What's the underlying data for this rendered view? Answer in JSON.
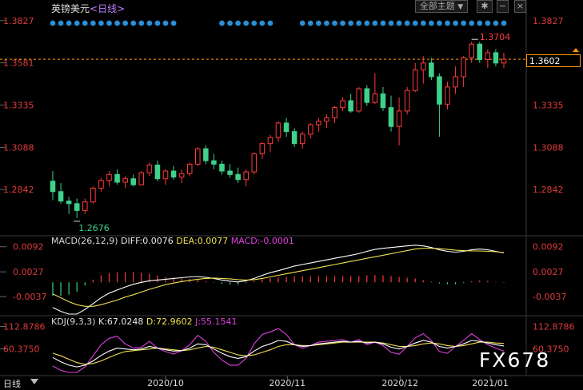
{
  "header": {
    "symbol_name": "英镑美元",
    "period_label": "<日线>",
    "theme_button": "全部主题",
    "theme_caret": "▼",
    "settings_glyph": "✱",
    "minus_glyph": "−",
    "close_glyph": "×"
  },
  "macd": {
    "label": "MACD(26,12,9)",
    "diff_text": "DIFF:0.0076",
    "dea_text": "DEA:0.0077",
    "macd_text": "MACD:-0.0001"
  },
  "kdj": {
    "label": "KDJ(9,3,3)",
    "k_text": "K:67.0248",
    "d_text": "D:72.9602",
    "j_text": "J:55.1541"
  },
  "price_badge": "1.3602",
  "bottom_bar": {
    "period": "日线"
  },
  "watermark": "FX678",
  "colors": {
    "up": "#ff3b3b",
    "down": "#3fd18a",
    "axis_label": "#e03a3a",
    "event_dot": "#2a8fd8",
    "dashed_line": "#ff9a00",
    "diff_line": "#ffffff",
    "dea_line": "#f0e050",
    "j_line": "#e040e0"
  },
  "chart_data": [
    {
      "type": "candlestick",
      "y_ticks": [
        "1.3827",
        "1.3581",
        "1.3335",
        "1.3088",
        "1.2842"
      ],
      "ylim": [
        1.2596,
        1.3882
      ],
      "x_ticks": [
        "2020/10",
        "2020/11",
        "2020/12",
        "2021/01"
      ],
      "dashed_level": 1.3602,
      "annotations": [
        {
          "label": "1.3704",
          "value": 1.3704,
          "kind": "high"
        },
        {
          "label": "1.2676",
          "value": 1.2676,
          "kind": "low"
        }
      ],
      "candles": [
        [
          1.2891,
          1.295,
          1.278,
          1.283
        ],
        [
          1.283,
          1.288,
          1.276,
          1.2775
        ],
        [
          1.2775,
          1.28,
          1.27,
          1.276
        ],
        [
          1.276,
          1.279,
          1.2676,
          1.272
        ],
        [
          1.272,
          1.279,
          1.27,
          1.277
        ],
        [
          1.277,
          1.286,
          1.276,
          1.285
        ],
        [
          1.285,
          1.291,
          1.283,
          1.2895
        ],
        [
          1.2895,
          1.295,
          1.286,
          1.293
        ],
        [
          1.293,
          1.296,
          1.287,
          1.2885
        ],
        [
          1.2885,
          1.292,
          1.285,
          1.2905
        ],
        [
          1.2905,
          1.293,
          1.286,
          1.287
        ],
        [
          1.287,
          1.295,
          1.2865,
          1.294
        ],
        [
          1.294,
          1.3,
          1.292,
          1.2985
        ],
        [
          1.2985,
          1.301,
          1.289,
          1.2905
        ],
        [
          1.2905,
          1.296,
          1.287,
          1.295
        ],
        [
          1.295,
          1.298,
          1.29,
          1.2915
        ],
        [
          1.2915,
          1.296,
          1.288,
          1.2935
        ],
        [
          1.2935,
          1.3,
          1.292,
          1.299
        ],
        [
          1.299,
          1.309,
          1.298,
          1.308
        ],
        [
          1.308,
          1.31,
          1.299,
          1.301
        ],
        [
          1.301,
          1.305,
          1.296,
          1.299
        ],
        [
          1.299,
          1.301,
          1.293,
          1.295
        ],
        [
          1.295,
          1.299,
          1.291,
          1.293
        ],
        [
          1.293,
          1.297,
          1.288,
          1.29
        ],
        [
          1.29,
          1.296,
          1.286,
          1.2945
        ],
        [
          1.2945,
          1.306,
          1.293,
          1.305
        ],
        [
          1.305,
          1.312,
          1.302,
          1.311
        ],
        [
          1.311,
          1.316,
          1.306,
          1.3145
        ],
        [
          1.3145,
          1.324,
          1.312,
          1.323
        ],
        [
          1.323,
          1.326,
          1.315,
          1.318
        ],
        [
          1.318,
          1.32,
          1.309,
          1.311
        ],
        [
          1.311,
          1.318,
          1.308,
          1.3165
        ],
        [
          1.3165,
          1.323,
          1.314,
          1.322
        ],
        [
          1.322,
          1.326,
          1.318,
          1.324
        ],
        [
          1.324,
          1.328,
          1.32,
          1.326
        ],
        [
          1.326,
          1.333,
          1.323,
          1.332
        ],
        [
          1.332,
          1.338,
          1.33,
          1.336
        ],
        [
          1.336,
          1.34,
          1.329,
          1.33
        ],
        [
          1.33,
          1.344,
          1.329,
          1.343
        ],
        [
          1.343,
          1.345,
          1.333,
          1.335
        ],
        [
          1.335,
          1.352,
          1.334,
          1.34
        ],
        [
          1.34,
          1.344,
          1.33,
          1.332
        ],
        [
          1.332,
          1.339,
          1.318,
          1.321
        ],
        [
          1.321,
          1.338,
          1.31,
          1.33
        ],
        [
          1.33,
          1.344,
          1.328,
          1.342
        ],
        [
          1.342,
          1.358,
          1.341,
          1.354
        ],
        [
          1.354,
          1.362,
          1.346,
          1.358
        ],
        [
          1.358,
          1.361,
          1.348,
          1.35
        ],
        [
          1.35,
          1.352,
          1.315,
          1.334
        ],
        [
          1.334,
          1.347,
          1.331,
          1.344
        ],
        [
          1.344,
          1.356,
          1.34,
          1.35
        ],
        [
          1.35,
          1.362,
          1.344,
          1.361
        ],
        [
          1.361,
          1.3704,
          1.358,
          1.369
        ],
        [
          1.369,
          1.3704,
          1.358,
          1.36
        ],
        [
          1.36,
          1.366,
          1.355,
          1.364
        ],
        [
          1.364,
          1.366,
          1.356,
          1.358
        ],
        [
          1.358,
          1.364,
          1.355,
          1.3602
        ]
      ]
    },
    {
      "type": "line",
      "name": "MACD",
      "y_ticks": [
        "0.0092",
        "0.0027",
        "-0.0037"
      ],
      "ylim": [
        -0.008,
        0.011
      ],
      "series": [
        {
          "name": "DIFF",
          "values": [
            -0.0065,
            -0.0075,
            -0.0082,
            -0.0082,
            -0.007,
            -0.0055,
            -0.004,
            -0.0028,
            -0.002,
            -0.0012,
            -0.0005,
            0.0,
            0.0004,
            0.0006,
            0.0008,
            0.001,
            0.0012,
            0.0014,
            0.0015,
            0.0013,
            0.001,
            0.0006,
            0.0003,
            0.0001,
            0.0004,
            0.001,
            0.0018,
            0.0025,
            0.003,
            0.0036,
            0.0042,
            0.0046,
            0.005,
            0.0054,
            0.0058,
            0.0062,
            0.0066,
            0.007,
            0.0074,
            0.008,
            0.0085,
            0.0088,
            0.009,
            0.0092,
            0.0094,
            0.0096,
            0.0094,
            0.009,
            0.0084,
            0.008,
            0.0078,
            0.008,
            0.0084,
            0.0086,
            0.0084,
            0.008,
            0.0076
          ]
        },
        {
          "name": "DEA",
          "values": [
            -0.003,
            -0.004,
            -0.005,
            -0.0058,
            -0.0062,
            -0.0062,
            -0.0058,
            -0.0052,
            -0.0046,
            -0.0038,
            -0.0032,
            -0.0025,
            -0.0018,
            -0.0012,
            -0.0006,
            -0.0002,
            0.0002,
            0.0005,
            0.0008,
            0.001,
            0.0011,
            0.001,
            0.0009,
            0.0007,
            0.0006,
            0.0007,
            0.001,
            0.0014,
            0.0018,
            0.0022,
            0.0026,
            0.003,
            0.0034,
            0.0038,
            0.0042,
            0.0046,
            0.005,
            0.0054,
            0.0058,
            0.0062,
            0.0066,
            0.007,
            0.0074,
            0.0078,
            0.0082,
            0.0086,
            0.0088,
            0.0088,
            0.0087,
            0.0085,
            0.0083,
            0.0082,
            0.0081,
            0.0081,
            0.008,
            0.0079,
            0.0077
          ]
        },
        {
          "name": "MACD",
          "values": [
            -0.0035,
            -0.0035,
            -0.0032,
            -0.0024,
            -0.0008,
            0.0007,
            0.0018,
            0.0024,
            0.0026,
            0.0026,
            0.0027,
            0.0025,
            0.0022,
            0.0018,
            0.0014,
            0.0012,
            0.001,
            0.0009,
            0.0007,
            0.0003,
            -0.0001,
            -0.0004,
            -0.0006,
            -0.0006,
            -0.0002,
            0.0003,
            0.0008,
            0.0011,
            0.0012,
            0.0014,
            0.0016,
            0.0016,
            0.0016,
            0.0016,
            0.0016,
            0.0016,
            0.0016,
            0.0016,
            0.0016,
            0.0018,
            0.0019,
            0.0018,
            0.0016,
            0.0014,
            0.0012,
            0.001,
            0.0006,
            0.0002,
            -0.0003,
            -0.0005,
            -0.0005,
            -0.0002,
            0.0003,
            0.0005,
            0.0004,
            0.0001,
            -0.0001
          ]
        }
      ]
    },
    {
      "type": "line",
      "name": "KDJ",
      "y_ticks": [
        "112.8786",
        "60.3750"
      ],
      "ylim": [
        5,
        125
      ],
      "series": [
        {
          "name": "K",
          "values": [
            40,
            30,
            22,
            18,
            22,
            32,
            45,
            55,
            62,
            60,
            58,
            60,
            66,
            62,
            58,
            55,
            56,
            62,
            72,
            70,
            60,
            50,
            42,
            38,
            42,
            55,
            66,
            72,
            80,
            78,
            70,
            66,
            68,
            72,
            74,
            76,
            78,
            76,
            78,
            74,
            76,
            72,
            64,
            60,
            66,
            74,
            80,
            76,
            66,
            62,
            66,
            72,
            80,
            78,
            74,
            70,
            67
          ]
        },
        {
          "name": "D",
          "values": [
            50,
            44,
            36,
            28,
            24,
            26,
            32,
            40,
            48,
            54,
            56,
            58,
            60,
            62,
            60,
            58,
            56,
            58,
            62,
            66,
            64,
            58,
            52,
            46,
            44,
            46,
            52,
            58,
            66,
            70,
            70,
            68,
            68,
            70,
            72,
            74,
            76,
            76,
            76,
            76,
            76,
            74,
            70,
            66,
            66,
            68,
            72,
            74,
            72,
            68,
            66,
            68,
            72,
            76,
            76,
            74,
            73
          ]
        },
        {
          "name": "J",
          "values": [
            20,
            10,
            5,
            5,
            18,
            44,
            70,
            85,
            90,
            72,
            62,
            64,
            78,
            62,
            54,
            48,
            56,
            70,
            92,
            78,
            52,
            34,
            22,
            22,
            38,
            72,
            94,
            100,
            108,
            94,
            70,
            62,
            68,
            76,
            78,
            80,
            82,
            76,
            82,
            70,
            76,
            68,
            52,
            48,
            66,
            86,
            96,
            80,
            54,
            50,
            66,
            80,
            96,
            82,
            70,
            62,
            55
          ]
        }
      ]
    }
  ]
}
